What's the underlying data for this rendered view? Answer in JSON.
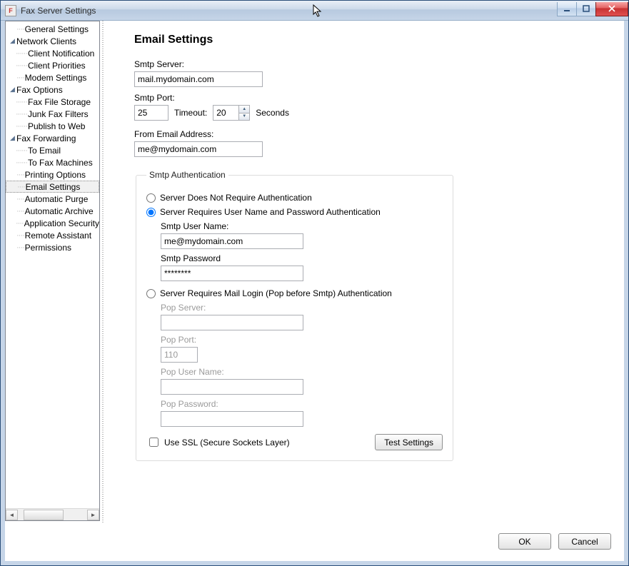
{
  "window": {
    "title": "Fax Server Settings"
  },
  "sidebar": {
    "items": [
      {
        "label": "General Settings",
        "expander": "none"
      },
      {
        "label": "Network Clients",
        "expander": "open",
        "children": [
          {
            "label": "Client Notification"
          },
          {
            "label": "Client Priorities"
          }
        ]
      },
      {
        "label": "Modem Settings",
        "expander": "none"
      },
      {
        "label": "Fax Options",
        "expander": "open",
        "children": [
          {
            "label": "Fax File Storage"
          },
          {
            "label": "Junk Fax Filters"
          },
          {
            "label": "Publish to Web"
          }
        ]
      },
      {
        "label": "Fax Forwarding",
        "expander": "open",
        "children": [
          {
            "label": "To Email"
          },
          {
            "label": "To Fax Machines"
          }
        ]
      },
      {
        "label": "Printing Options",
        "expander": "none"
      },
      {
        "label": "Email Settings",
        "expander": "none",
        "selected": true
      },
      {
        "label": "Automatic Purge",
        "expander": "none"
      },
      {
        "label": "Automatic Archive",
        "expander": "none"
      },
      {
        "label": "Application Security",
        "expander": "none"
      },
      {
        "label": "Remote Assistant",
        "expander": "none"
      },
      {
        "label": "Permissions",
        "expander": "none"
      }
    ]
  },
  "page": {
    "heading": "Email Settings",
    "smtp_server_label": "Smtp Server:",
    "smtp_server_value": "mail.mydomain.com",
    "smtp_port_label": "Smtp Port:",
    "smtp_port_value": "25",
    "timeout_label": "Timeout:",
    "timeout_value": "20",
    "timeout_unit": "Seconds",
    "from_label": "From Email Address:",
    "from_value": "me@mydomain.com"
  },
  "auth": {
    "legend": "Smtp Authentication",
    "opt_none": "Server Does Not Require Authentication",
    "opt_userpass": "Server Requires User Name and Password Authentication",
    "opt_pop": "Server Requires Mail Login (Pop before Smtp) Authentication",
    "selected": "userpass",
    "smtp_user_label": "Smtp User Name:",
    "smtp_user_value": "me@mydomain.com",
    "smtp_pass_label": "Smtp Password",
    "smtp_pass_value": "********",
    "pop_server_label": "Pop Server:",
    "pop_server_value": "",
    "pop_port_label": "Pop Port:",
    "pop_port_value": "110",
    "pop_user_label": "Pop User Name:",
    "pop_user_value": "",
    "pop_pass_label": "Pop Password:",
    "pop_pass_value": "",
    "ssl_label": "Use SSL (Secure Sockets Layer)",
    "ssl_checked": false,
    "test_label": "Test Settings"
  },
  "footer": {
    "ok": "OK",
    "cancel": "Cancel"
  }
}
